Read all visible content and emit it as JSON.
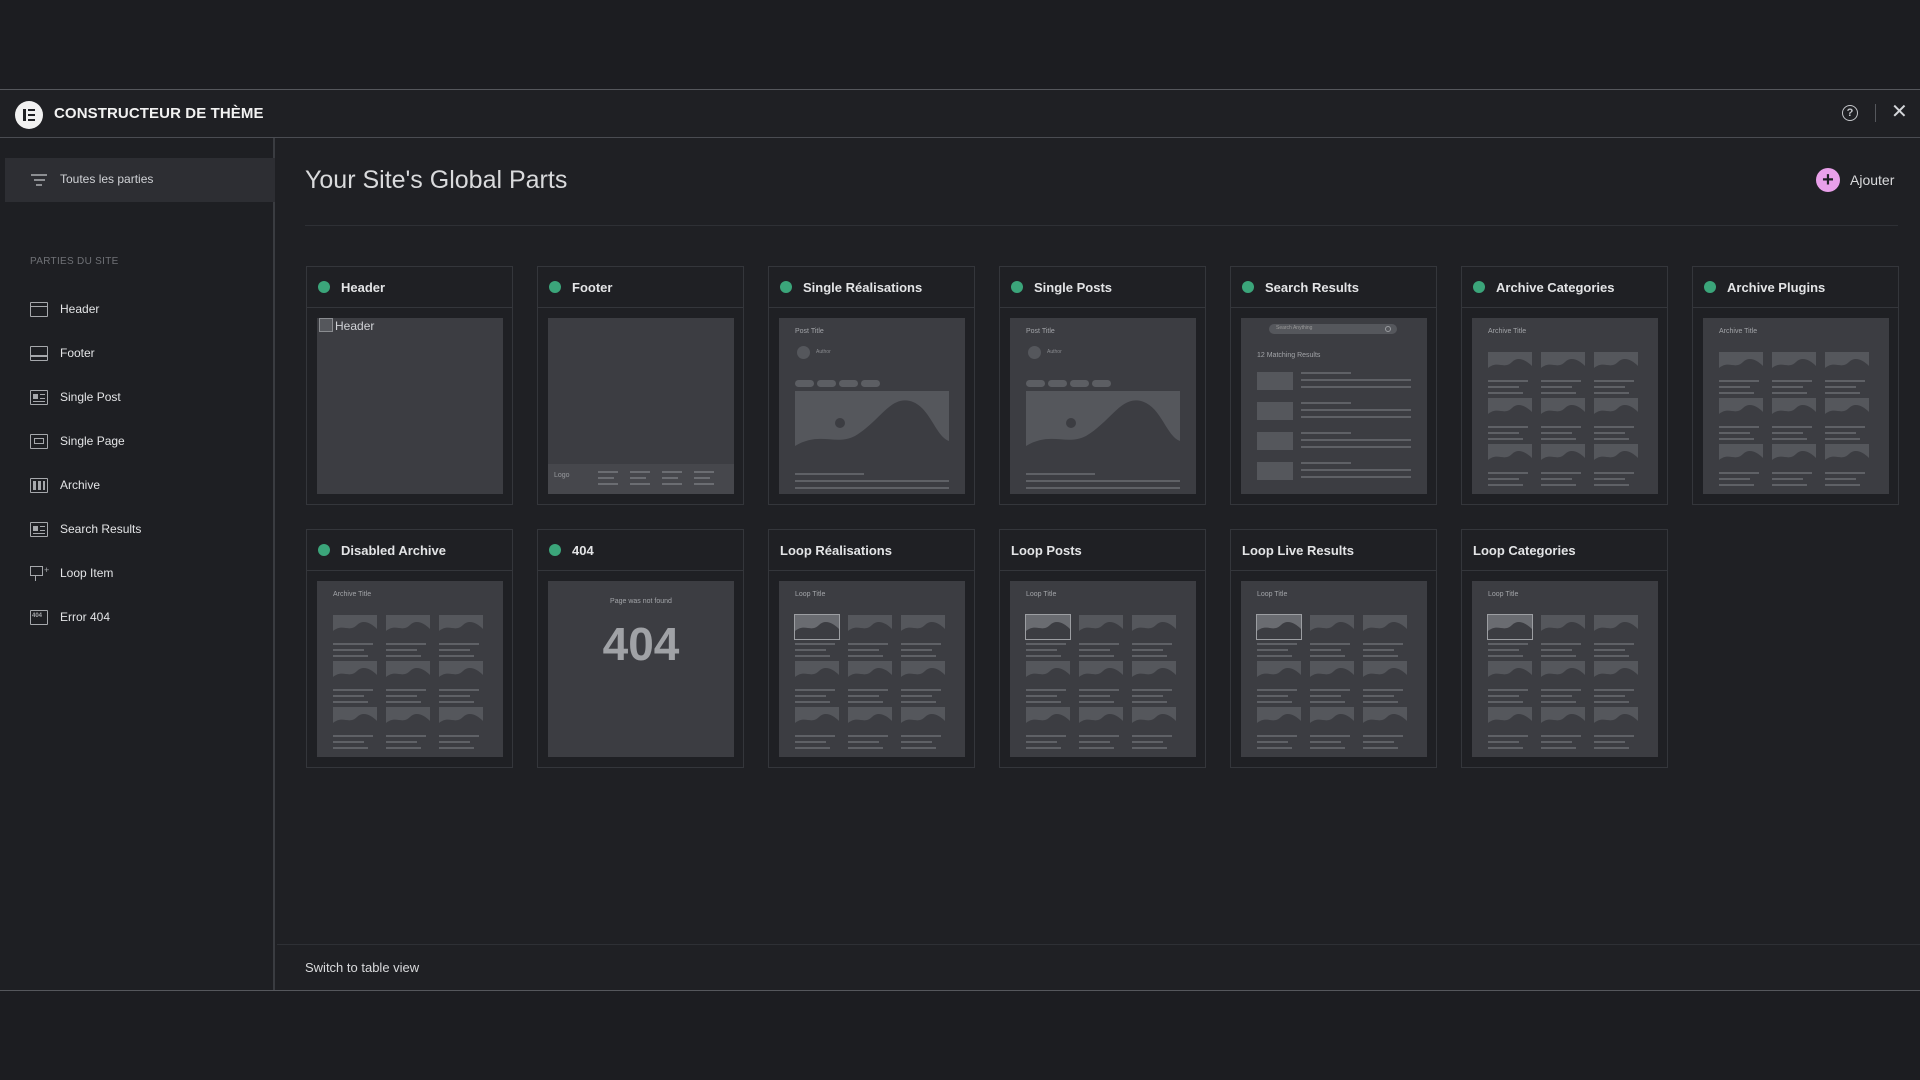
{
  "app": {
    "title": "CONSTRUCTEUR DE THÈME",
    "logo_icon": "elementor-logo-icon",
    "help_icon": "help-icon",
    "close_icon": "close-icon"
  },
  "sidebar": {
    "all_parts_label": "Toutes les parties",
    "section_label": "PARTIES DU SITE",
    "items": [
      {
        "label": "Header",
        "icon": "header-icon"
      },
      {
        "label": "Footer",
        "icon": "footer-icon"
      },
      {
        "label": "Single Post",
        "icon": "single-post-icon"
      },
      {
        "label": "Single Page",
        "icon": "single-page-icon"
      },
      {
        "label": "Archive",
        "icon": "archive-icon"
      },
      {
        "label": "Search Results",
        "icon": "search-results-icon"
      },
      {
        "label": "Loop Item",
        "icon": "loop-item-icon"
      },
      {
        "label": "Error 404",
        "icon": "error-404-icon"
      }
    ]
  },
  "main": {
    "page_title": "Your Site's Global Parts",
    "add_label": "Ajouter",
    "switch_view_label": "Switch to table view",
    "status_color": "#3ba57a",
    "accent_color": "#e9a0ea",
    "cards": [
      {
        "name": "Header",
        "active": true,
        "thumb": "image-alt",
        "alt_text": "Header"
      },
      {
        "name": "Footer",
        "active": true,
        "thumb": "footer",
        "logo_text": "Logo"
      },
      {
        "name": "Single Réalisations",
        "active": true,
        "thumb": "single",
        "post_title": "Post Title",
        "author": "Author"
      },
      {
        "name": "Single Posts",
        "active": true,
        "thumb": "single",
        "post_title": "Post Title",
        "author": "Author"
      },
      {
        "name": "Search Results",
        "active": true,
        "thumb": "search",
        "search_placeholder": "Search Anything",
        "results_text": "12 Matching Results"
      },
      {
        "name": "Archive Categories",
        "active": true,
        "thumb": "archive",
        "archive_title": "Archive Title"
      },
      {
        "name": "Archive Plugins",
        "active": true,
        "thumb": "archive",
        "archive_title": "Archive Title"
      },
      {
        "name": "Disabled Archive",
        "active": true,
        "thumb": "archive",
        "archive_title": "Archive Title"
      },
      {
        "name": "404",
        "active": true,
        "thumb": "404",
        "not_found_text": "Page was not found",
        "code": "404"
      },
      {
        "name": "Loop Réalisations",
        "active": false,
        "thumb": "loop",
        "loop_title": "Loop Title"
      },
      {
        "name": "Loop Posts",
        "active": false,
        "thumb": "loop",
        "loop_title": "Loop Title"
      },
      {
        "name": "Loop Live Results",
        "active": false,
        "thumb": "loop",
        "loop_title": "Loop Title"
      },
      {
        "name": "Loop Categories",
        "active": false,
        "thumb": "loop",
        "loop_title": "Loop Title"
      }
    ]
  }
}
